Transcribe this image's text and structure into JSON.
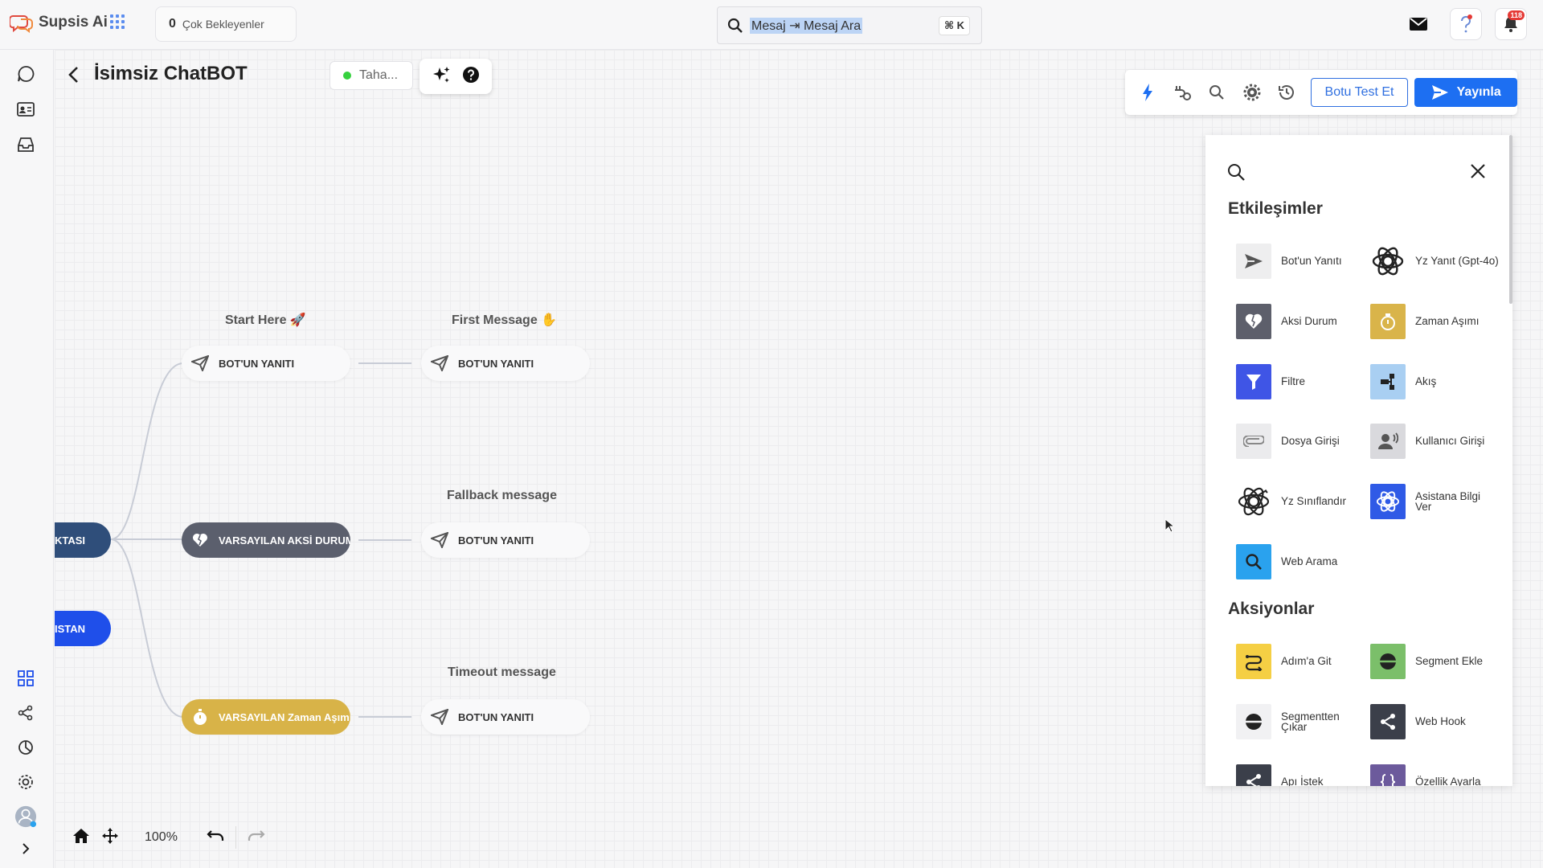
{
  "app": {
    "name": "Supsis Ai"
  },
  "waiting": {
    "count": "0",
    "label": "Çok Bekleyenler"
  },
  "search": {
    "query": "Mesaj ⇥ Mesaj Ara",
    "shortcut": "⌘ K"
  },
  "notifications": {
    "count": "118"
  },
  "page": {
    "title": "İsimsiz ChatBOT",
    "user": "Taha..."
  },
  "toolbar": {
    "test_label": "Botu Test Et",
    "publish_label": "Yayınla"
  },
  "flow": {
    "labels": {
      "start": "Start Here 🚀",
      "first": "First Message ✋",
      "fallback": "Fallback message",
      "timeout": "Timeout message"
    },
    "nodes": {
      "reply": "BOT'UN YANITI",
      "start_point": "KTASI",
      "assistant": "ISTAN",
      "fallback": "VARSAYILAN AKSİ DURUM",
      "timeout": "VARSAYILAN Zaman Aşımı"
    }
  },
  "panel": {
    "interactions_title": "Etkileşimler",
    "actions_title": "Aksiyonlar",
    "interactions": [
      {
        "label": "Bot'un Yanıtı",
        "icon": "send-icon",
        "color": "#eeeeef"
      },
      {
        "label": "Yz Yanıt (Gpt-4o)",
        "icon": "openai-icon",
        "color": "#ffffff"
      },
      {
        "label": "Aksi Durum",
        "icon": "broken-heart-icon",
        "color": "#5d5f6b"
      },
      {
        "label": "Zaman Aşımı",
        "icon": "timer-icon",
        "color": "#d9b44a"
      },
      {
        "label": "Filtre",
        "icon": "filter-icon",
        "color": "#3f55e6"
      },
      {
        "label": "Akış",
        "icon": "flow-icon",
        "color": "#a9cff2"
      },
      {
        "label": "Dosya Girişi",
        "icon": "paperclip-icon",
        "color": "#ebebed"
      },
      {
        "label": "Kullanıcı Girişi",
        "icon": "user-voice-icon",
        "color": "#d9d9dd"
      },
      {
        "label": "Yz Sınıflandır",
        "icon": "openai-icon",
        "color": "#ffffff"
      },
      {
        "label": "Asistana Bilgi Ver",
        "icon": "openai-icon",
        "color": "#2f5ae6"
      },
      {
        "label": "Web Arama",
        "icon": "search-icon",
        "color": "#2aa2ee"
      }
    ],
    "actions": [
      {
        "label": "Adım'a Git",
        "icon": "goto-icon",
        "color": "#f5cf44"
      },
      {
        "label": "Segment Ekle",
        "icon": "segment-add-icon",
        "color": "#7bbf6a"
      },
      {
        "label": "Segmentten Çıkar",
        "icon": "segment-remove-icon",
        "color": "#f1f1f3"
      },
      {
        "label": "Web Hook",
        "icon": "share-icon",
        "color": "#3b3f4a"
      },
      {
        "label": "Apı İstek",
        "icon": "share-icon",
        "color": "#3b3f4a"
      },
      {
        "label": "Özellik Ayarla",
        "icon": "braces-icon",
        "color": "#6c5a9c"
      }
    ]
  },
  "bottom": {
    "zoom": "100%"
  }
}
